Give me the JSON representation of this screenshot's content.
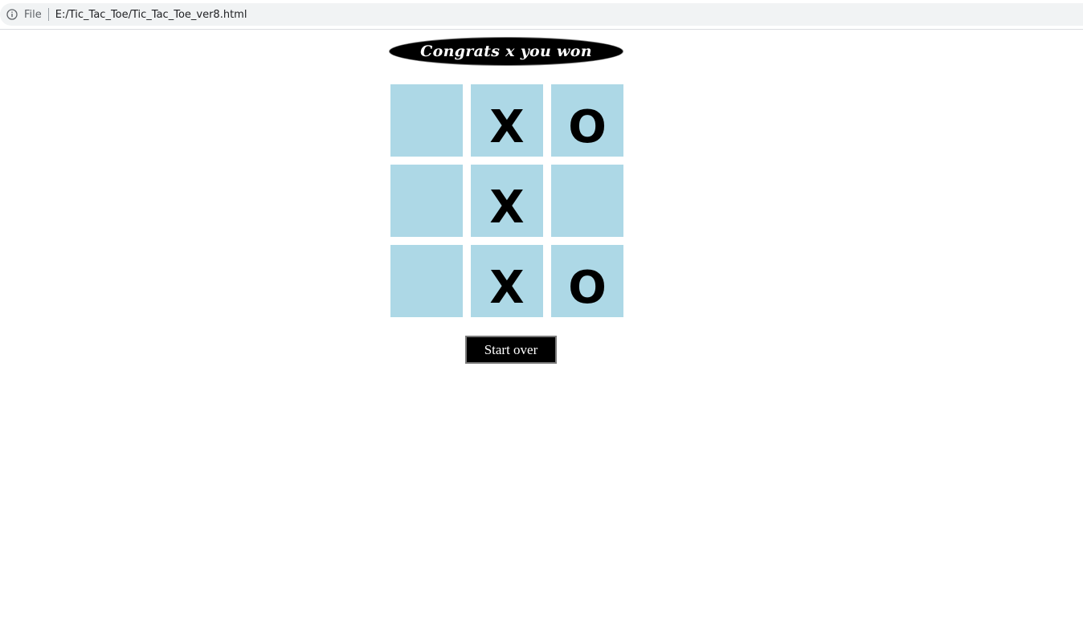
{
  "browser": {
    "scheme_label": "File",
    "url": "E:/Tic_Tac_Toe/Tic_Tac_Toe_ver8.html",
    "info_icon": "info-circle-icon"
  },
  "game": {
    "banner_text": "Congrats x you won",
    "cells": [
      "",
      "X",
      "O",
      "",
      "X",
      "",
      "",
      "X",
      "O"
    ],
    "start_over_label": "Start over",
    "cell_color": "#add8e6",
    "mark_color": "#000000"
  }
}
